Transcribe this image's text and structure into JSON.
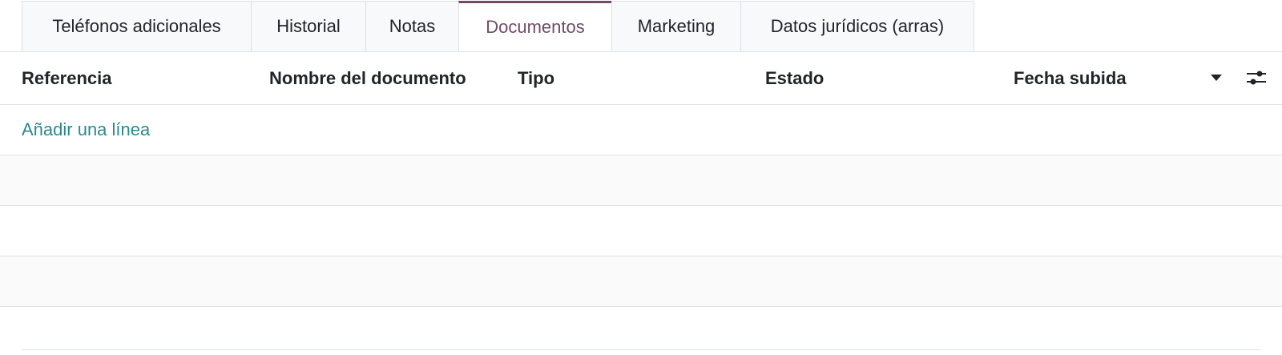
{
  "tabs": [
    {
      "label": "Teléfonos adicionales",
      "active": false
    },
    {
      "label": "Historial",
      "active": false
    },
    {
      "label": "Notas",
      "active": false
    },
    {
      "label": "Documentos",
      "active": true
    },
    {
      "label": "Marketing",
      "active": false
    },
    {
      "label": "Datos jurídicos (arras)",
      "active": false
    }
  ],
  "table": {
    "columns": [
      "Referencia",
      "Nombre del documento",
      "Tipo",
      "Estado",
      "Fecha subida"
    ],
    "add_line_label": "Añadir una línea",
    "rows": []
  },
  "colors": {
    "accent": "#714b67",
    "link": "#2b8a8f",
    "border": "#dee2e6",
    "stripe": "#fafafa"
  },
  "icons": {
    "sort": "caret-down-icon",
    "optional_columns": "sliders-icon"
  }
}
